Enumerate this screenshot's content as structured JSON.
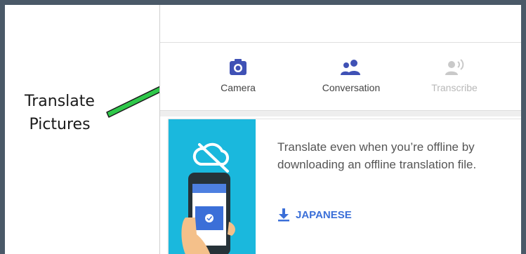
{
  "annotation": {
    "lines": [
      "Translate",
      "Pictures"
    ]
  },
  "modes": [
    {
      "label": "Camera",
      "icon": "camera-icon"
    },
    {
      "label": "Conversation",
      "icon": "people-icon"
    },
    {
      "label": "Transcribe",
      "icon": "transcribe-icon",
      "disabled": true
    }
  ],
  "offline_card": {
    "message": "Translate even when you’re offline by downloading an offline translation file.",
    "action_label": "JAPANESE",
    "action_icon": "download-icon"
  },
  "colors": {
    "frame_border": "#4a5968",
    "arrow": "#2fc84a",
    "icon_primary": "#3f51b5",
    "icon_disabled": "#c9c9c9",
    "link": "#3b6fd8",
    "illustration_bg": "#1ab8dd"
  }
}
